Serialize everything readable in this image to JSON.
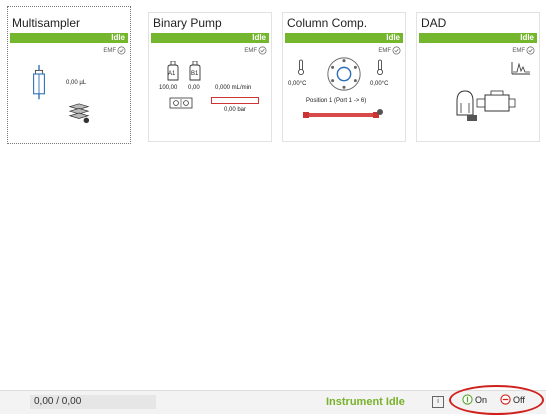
{
  "modules": [
    {
      "title": "Multisampler",
      "status": "Idle",
      "emf": "EMF",
      "volume": "0,00 µL"
    },
    {
      "title": "Binary Pump",
      "status": "Idle",
      "emf": "EMF",
      "bottle_a": "A1",
      "bottle_b": "B1",
      "pct_a": "100,00",
      "pct_b": "0,00",
      "flow": "0,000 mL/min",
      "pressure": "0,00 bar"
    },
    {
      "title": "Column Comp.",
      "status": "Idle",
      "emf": "EMF",
      "temp_left": "0,00°C",
      "temp_right": "0,00°C",
      "position": "Position 1 (Port 1 -> 6)"
    },
    {
      "title": "DAD",
      "status": "Idle",
      "emf": "EMF"
    }
  ],
  "footer": {
    "position": "0,00 / 0,00",
    "instrument_status": "Instrument Idle",
    "info": "i",
    "on_label": "On",
    "off_label": "Off"
  },
  "colors": {
    "status_green": "#74b72e",
    "annotation_red": "#d0201b"
  }
}
